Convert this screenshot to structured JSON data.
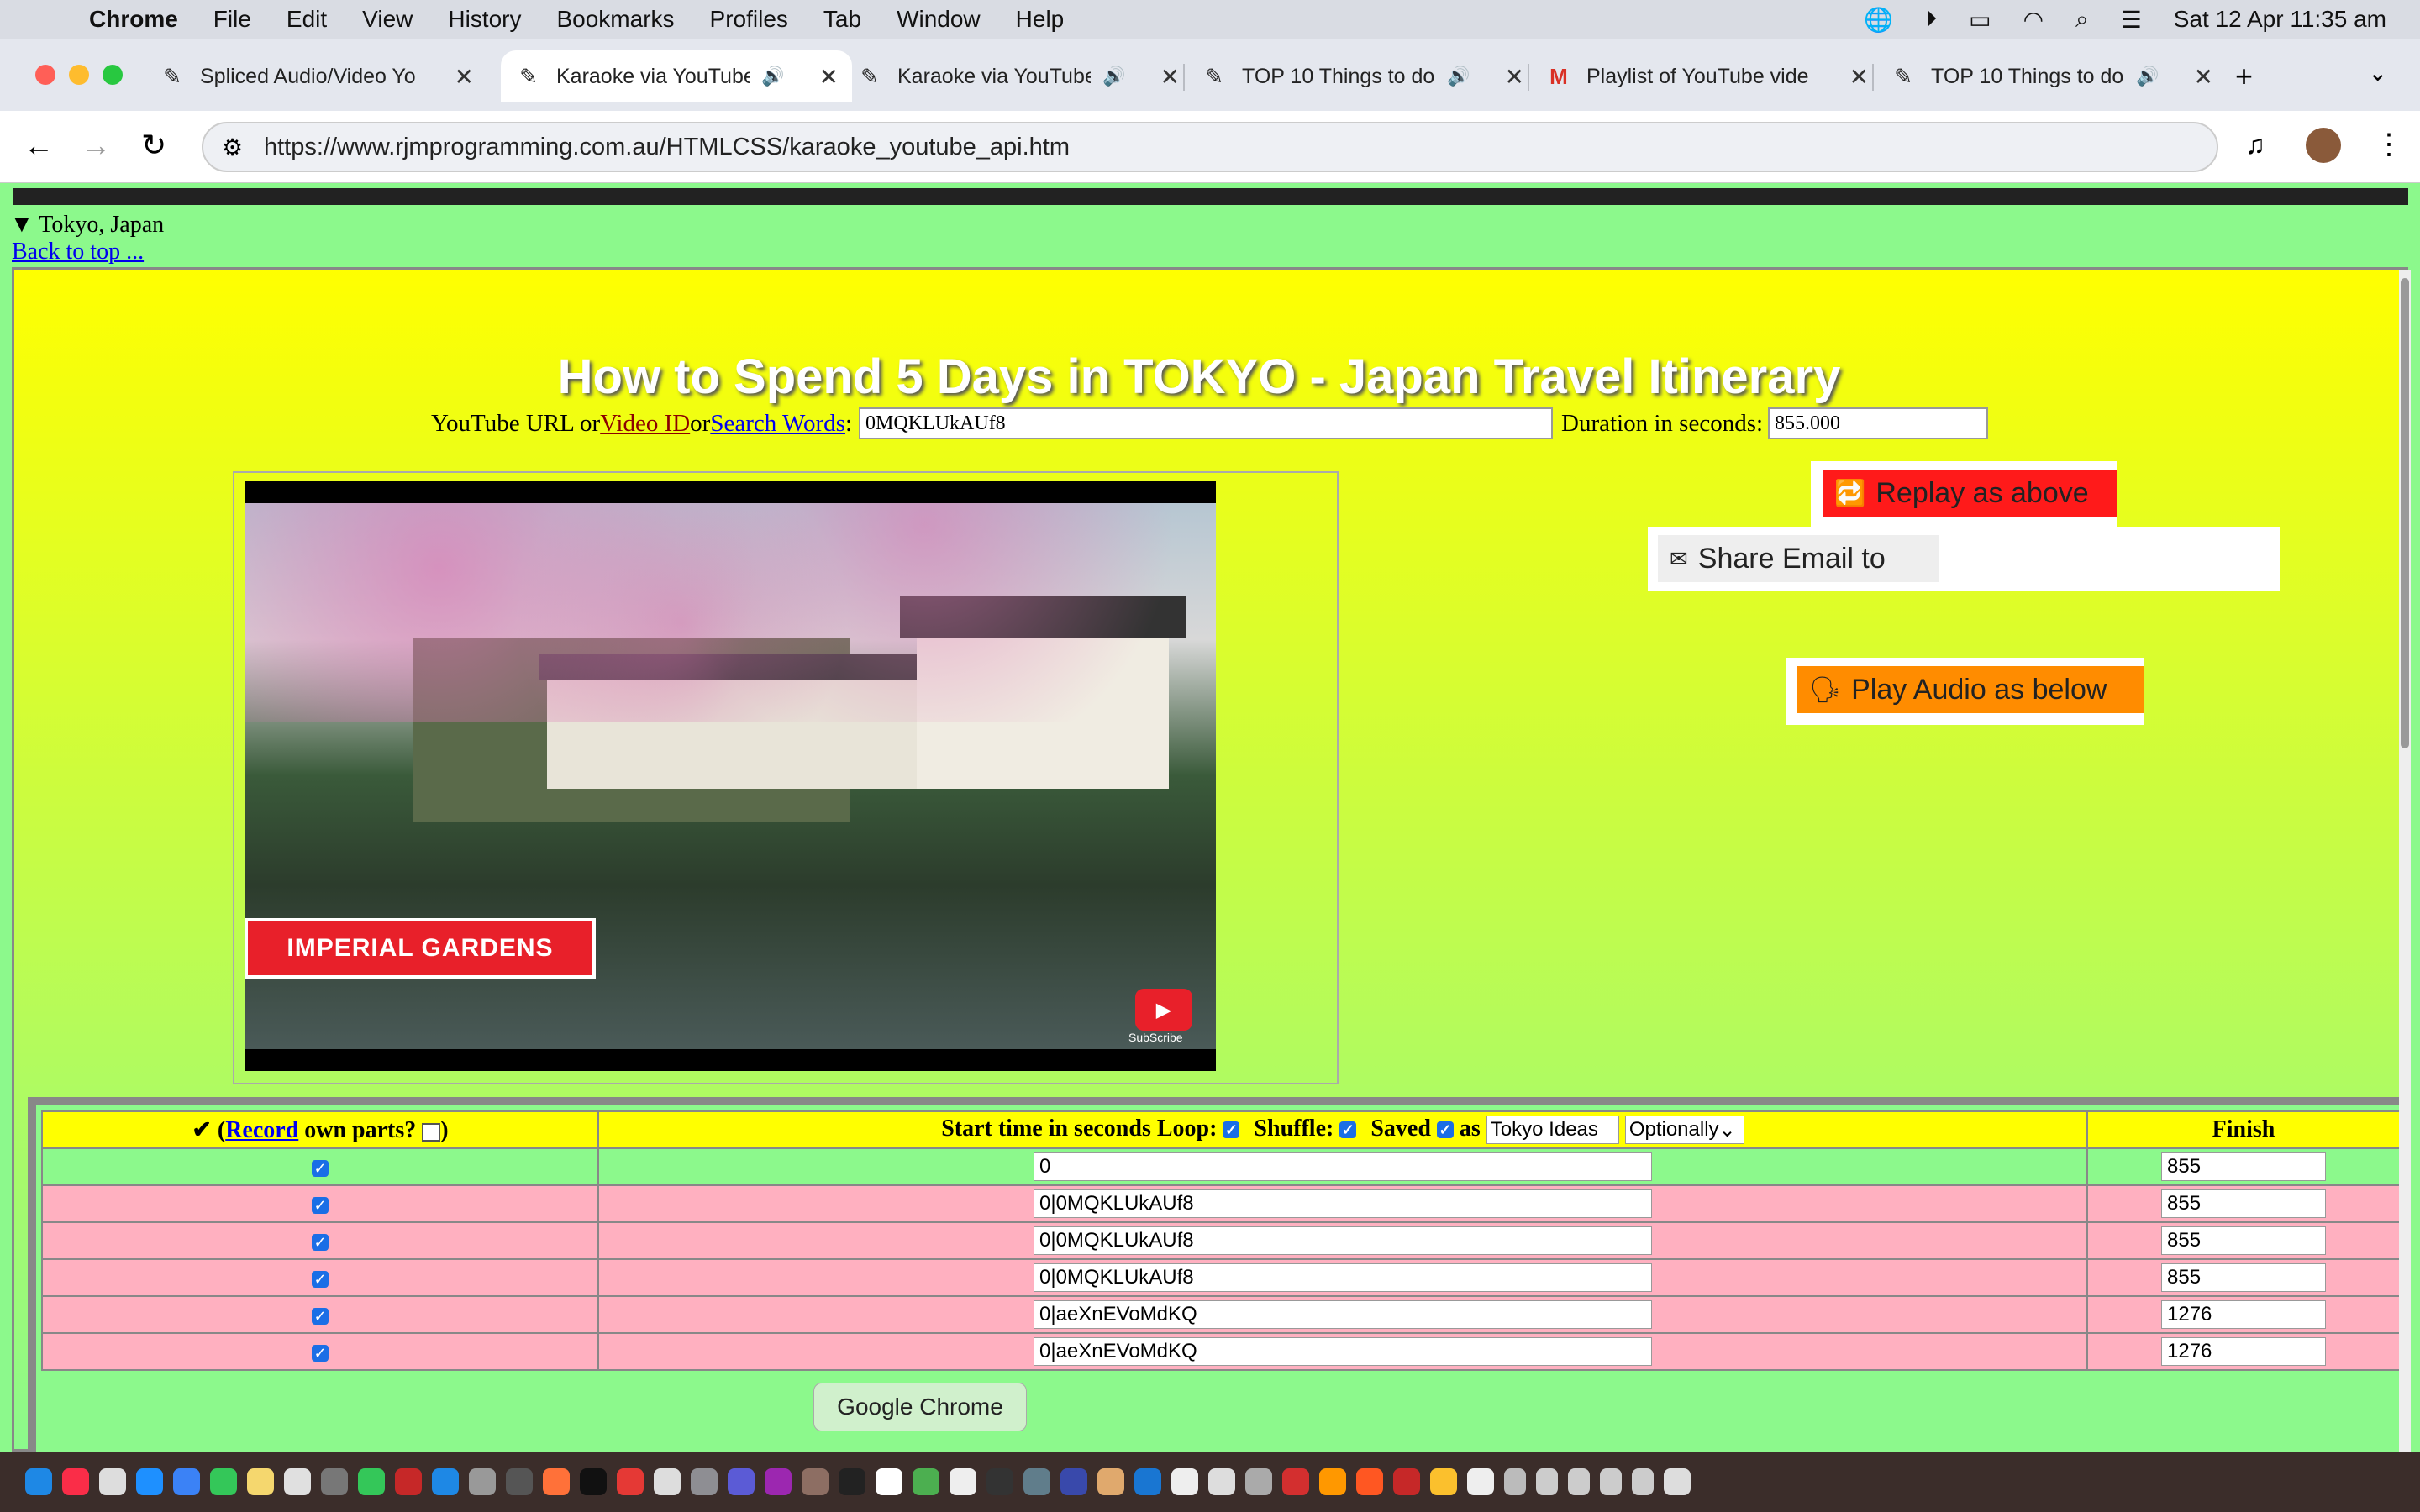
{
  "menubar": {
    "app": "Chrome",
    "items": [
      "File",
      "Edit",
      "View",
      "History",
      "Bookmarks",
      "Profiles",
      "Tab",
      "Window",
      "Help"
    ],
    "clock": "Sat 12 Apr  11:35 am"
  },
  "tabs": [
    {
      "title": "Spliced Audio/Video Yo"
    },
    {
      "title": "Karaoke via YouTube"
    },
    {
      "title": "Karaoke via YouTube"
    },
    {
      "title": "TOP 10 Things to do"
    },
    {
      "title": "Playlist of YouTube vide"
    },
    {
      "title": "TOP 10 Things to do"
    }
  ],
  "address": {
    "url": "https://www.rjmprogramming.com.au/HTMLCSS/karaoke_youtube_api.htm"
  },
  "page": {
    "summary": "Tokyo, Japan",
    "back_link": "Back to top ...",
    "video_title": "How to Spend 5 Days in TOKYO - Japan Travel Itinerary",
    "url_label": "YouTube URL or ",
    "video_id_link": "Video ID",
    "or": " or ",
    "search_link": "Search Words",
    "colon": ": ",
    "video_id_value": "0MQKLUkAUf8",
    "duration_label": "Duration in seconds: ",
    "duration_value": "855.000",
    "video_caption": "IMPERIAL GARDENS",
    "subscribe": "SubScribe",
    "replay_btn": "Replay as above",
    "share_btn": "Share Email to",
    "play_audio_btn": "Play Audio as below"
  },
  "table": {
    "h_check_prefix": "✔ (",
    "h_record_link": "Record",
    "h_own_parts": " own parts? ",
    "h_close": ")",
    "h_start": "Start time in seconds  Loop:",
    "h_shuffle": "Shuffle:",
    "h_saved": "Saved",
    "h_as": "as",
    "h_saved_name": "Tokyo Ideas",
    "h_optionally": "Optionally",
    "h_finish": "Finish",
    "rows": [
      {
        "start": "0",
        "finish": "855"
      },
      {
        "start": "0|0MQKLUkAUf8",
        "finish": "855"
      },
      {
        "start": "0|0MQKLUkAUf8",
        "finish": "855"
      },
      {
        "start": "0|0MQKLUkAUf8",
        "finish": "855"
      },
      {
        "start": "0|aeXnEVoMdKQ",
        "finish": "1276"
      },
      {
        "start": "0|aeXnEVoMdKQ",
        "finish": "1276"
      }
    ]
  },
  "tooltip": "Google Chrome",
  "colors": {
    "yellow": "#ffff00",
    "green": "#8cf98c",
    "pink": "#ffb0c0",
    "red_btn": "#ff1a1a",
    "orange_btn": "#ff8c00"
  }
}
